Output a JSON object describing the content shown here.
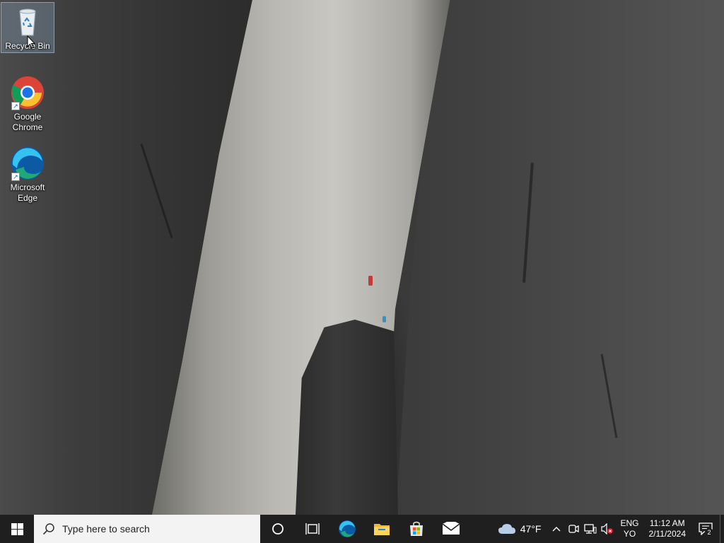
{
  "desktop": {
    "icons": [
      {
        "label": "Recycle Bin"
      },
      {
        "label": "Google Chrome"
      },
      {
        "label": "Microsoft Edge"
      }
    ]
  },
  "taskbar": {
    "search_placeholder": "Type here to search",
    "pinned": [
      {
        "name": "cortana-icon"
      },
      {
        "name": "task-view-icon"
      },
      {
        "name": "edge-icon"
      },
      {
        "name": "file-explorer-icon"
      },
      {
        "name": "microsoft-store-icon"
      },
      {
        "name": "mail-icon"
      }
    ],
    "weather": {
      "temperature": "47°F",
      "icon": "cloud-icon"
    },
    "language": {
      "line1": "ENG",
      "line2": "YO"
    },
    "clock": {
      "time": "11:12 AM",
      "date": "2/11/2024"
    },
    "notifications": {
      "count": "2"
    }
  },
  "colors": {
    "taskbar_bg": "#1f1f1f",
    "search_bg": "#f3f3f3",
    "accent_blue": "#0078d4"
  }
}
